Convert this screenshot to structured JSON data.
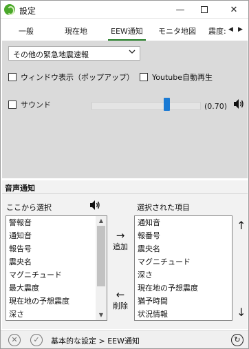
{
  "window": {
    "title": "設定",
    "minimize_symbol": "—",
    "close_symbol": "✕"
  },
  "tabs": [
    {
      "label": "一般",
      "active": false
    },
    {
      "label": "現在地",
      "active": false
    },
    {
      "label": "EEW通知",
      "active": true
    },
    {
      "label": "モニタ地図",
      "active": false
    },
    {
      "label": "震度:",
      "active": false
    }
  ],
  "tab_scroll": {
    "left": "◀",
    "right": "▶"
  },
  "eew": {
    "select_value": "その他の緊急地震速報",
    "window_popup_label": "ウィンドウ表示（ポップアップ）",
    "window_popup_checked": false,
    "youtube_label": "Youtube自動再生",
    "youtube_checked": false,
    "sound_label": "サウンド",
    "sound_checked": false,
    "volume_text": "(0.70)",
    "volume_level": 0.7
  },
  "voice": {
    "section_title": "音声通知",
    "source_label": "ここから選択",
    "selected_label": "選択された項目",
    "source_items": [
      "警報音",
      "通知音",
      "報告号",
      "震央名",
      "マグニチュード",
      "最大震度",
      "現在地の予想震度",
      "深さ"
    ],
    "selected_items": [
      "通知音",
      "報番号",
      "震央名",
      "マグニチュード",
      "深さ",
      "現在地の予想震度",
      "猶予時間",
      "状況情報"
    ],
    "add_label": "追加",
    "add_arrow": "→",
    "remove_label": "削除",
    "remove_arrow": "←",
    "up_arrow": "↑",
    "down_arrow": "↓"
  },
  "bottom": {
    "cancel_symbol": "✕",
    "ok_symbol": "✓",
    "breadcrumb": "基本的な設定 > EEW通知",
    "reset_symbol": "↻"
  },
  "colors": {
    "accent_green": "#1f7a22",
    "slider_thumb": "#1a7ad4"
  }
}
